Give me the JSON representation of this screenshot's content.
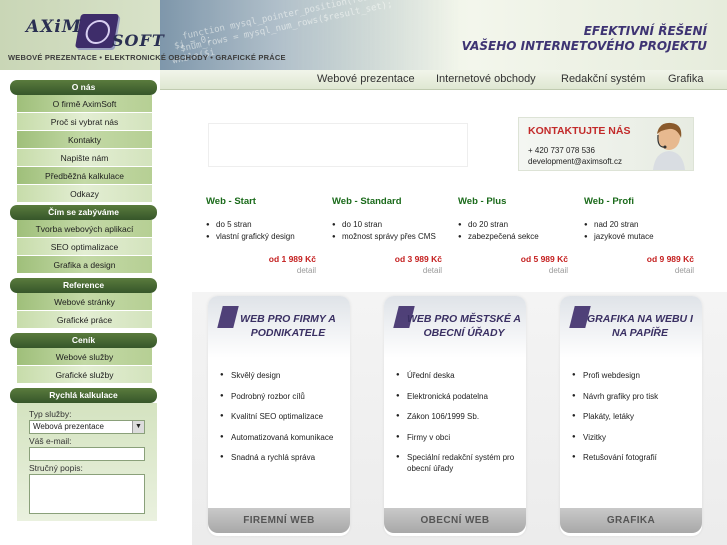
{
  "header": {
    "logo_left": "AXiM",
    "logo_right": "SOFT",
    "tagline": "WEBOVÉ PREZENTACE • ELEKTRONICKÉ OBCHODY • GRAFICKÉ PRÁCE",
    "slogan_line1": "EFEKTIVNÍ ŘEŠENÍ",
    "slogan_line2": "VAŠEHO INTERNETOVÉHO PROJEKTU",
    "code_lines": [
      "function mysql_pointer_position(result_set)",
      "$num_rows = mysql_num_rows($result_set);",
      "$i = 0;",
      "while($i"
    ]
  },
  "topnav": [
    "Webové prezentace",
    "Internetové obchody",
    "Redakční systém",
    "Grafika"
  ],
  "sidebar": {
    "sections": [
      {
        "title": "O nás",
        "items": [
          "O firmě AximSoft",
          "Proč si vybrat nás",
          "Kontakty",
          "Napište nám",
          "Předběžná kalkulace",
          "Odkazy"
        ]
      },
      {
        "title": "Čím se zabýváme",
        "items": [
          "Tvorba webových aplikací",
          "SEO optimalizace",
          "Grafika a design"
        ]
      },
      {
        "title": "Reference",
        "items": [
          "Webové stránky",
          "Grafické práce"
        ]
      },
      {
        "title": "Ceník",
        "items": [
          "Webové služby",
          "Grafické služby"
        ]
      }
    ],
    "calc": {
      "title": "Rychlá kalkulace",
      "type_label": "Typ služby:",
      "type_value": "Webová prezentace",
      "email_label": "Váš e-mail:",
      "desc_label": "Stručný popis:"
    }
  },
  "contact": {
    "title": "KONTAKTUJTE NÁS",
    "phone": "+ 420 737 078 536",
    "email": "development@aximsoft.cz"
  },
  "packages": [
    {
      "title": "Web - Start",
      "items": [
        "do 5 stran",
        "vlastní grafický design"
      ],
      "price": "od 1 989 Kč",
      "detail": "detail"
    },
    {
      "title": "Web - Standard",
      "items": [
        "do 10 stran",
        "možnost správy přes CMS"
      ],
      "price": "od 3 989 Kč",
      "detail": "detail"
    },
    {
      "title": "Web - Plus",
      "items": [
        "do 20 stran",
        "zabezpečená sekce"
      ],
      "price": "od 5 989 Kč",
      "detail": "detail"
    },
    {
      "title": "Web - Profi",
      "items": [
        "nad 20 stran",
        "jazykové mutace"
      ],
      "price": "od 9 989 Kč",
      "detail": "detail"
    }
  ],
  "features": [
    {
      "title": "WEB PRO FIRMY A PODNIKATELE",
      "items": [
        "Skvělý design",
        "Podrobný rozbor cílů",
        "Kvalitní SEO optimalizace",
        "Automatizovaná komunikace",
        "Snadná a rychlá správa"
      ],
      "button": "FIREMNÍ WEB"
    },
    {
      "title": "WEB PRO MĚSTSKÉ A OBECNÍ ÚŘADY",
      "items": [
        "Úřední deska",
        "Elektronická podatelna",
        "Zákon 106/1999 Sb.",
        "Firmy v obci",
        "Speciální redakční systém pro obecní úřady"
      ],
      "button": "OBECNÍ WEB"
    },
    {
      "title": "GRAFIKA NA WEBU I NA PAPÍŘE",
      "items": [
        "Profi webdesign",
        "Návrh grafiky pro tisk",
        "Plakáty, letáky",
        "Vizitky",
        "Retušování fotografií"
      ],
      "button": "GRAFIKA"
    }
  ]
}
